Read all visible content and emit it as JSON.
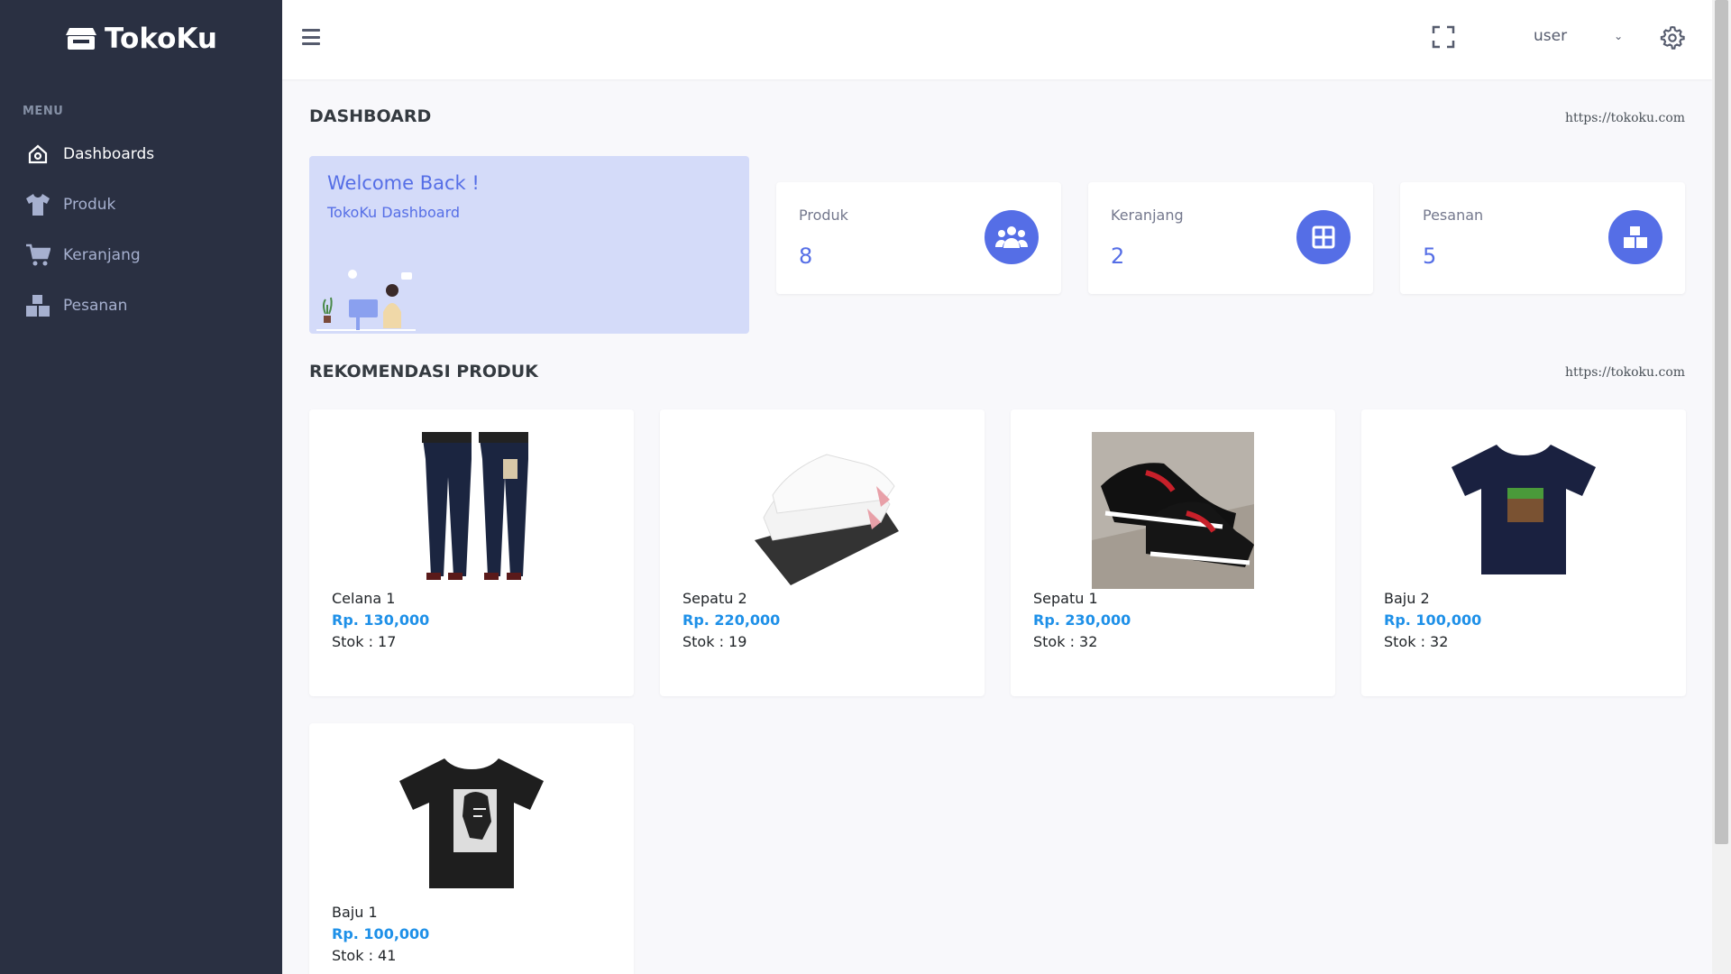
{
  "app": {
    "brand": "TokoKu"
  },
  "sidebar": {
    "menu_title": "MENU",
    "items": [
      {
        "label": "Dashboards",
        "icon": "home-icon",
        "active": true
      },
      {
        "label": "Produk",
        "icon": "tshirt-icon"
      },
      {
        "label": "Keranjang",
        "icon": "cart-icon"
      },
      {
        "label": "Pesanan",
        "icon": "boxes-icon"
      }
    ]
  },
  "topbar": {
    "user": "user"
  },
  "page": {
    "title": "DASHBOARD",
    "url": "https://tokoku.com"
  },
  "welcome": {
    "heading": "Welcome Back !",
    "subtitle": "TokoKu Dashboard"
  },
  "stats": [
    {
      "label": "Produk",
      "value": "8",
      "icon": "users-icon"
    },
    {
      "label": "Keranjang",
      "value": "2",
      "icon": "grid-icon"
    },
    {
      "label": "Pesanan",
      "value": "5",
      "icon": "boxes-icon"
    }
  ],
  "recommendations": {
    "title": "REKOMENDASI PRODUK",
    "url": "https://tokoku.com",
    "products": [
      {
        "name": "Celana 1",
        "price": "Rp. 130,000",
        "stock": "Stok : 17",
        "image": "jeans"
      },
      {
        "name": "Sepatu 2",
        "price": "Rp. 220,000",
        "stock": "Stok : 19",
        "image": "white-sneakers"
      },
      {
        "name": "Sepatu 1",
        "price": "Rp. 230,000",
        "stock": "Stok : 32",
        "image": "black-red-sneakers"
      },
      {
        "name": "Baju 2",
        "price": "Rp. 100,000",
        "stock": "Stok : 32",
        "image": "navy-tshirt"
      },
      {
        "name": "Baju 1",
        "price": "Rp. 100,000",
        "stock": "Stok : 41",
        "image": "black-tshirt"
      }
    ]
  },
  "colors": {
    "sidebar": "#2a3042",
    "primary": "#556ee6",
    "price": "#1e90e8",
    "welcome_bg": "#d4dbf9"
  }
}
